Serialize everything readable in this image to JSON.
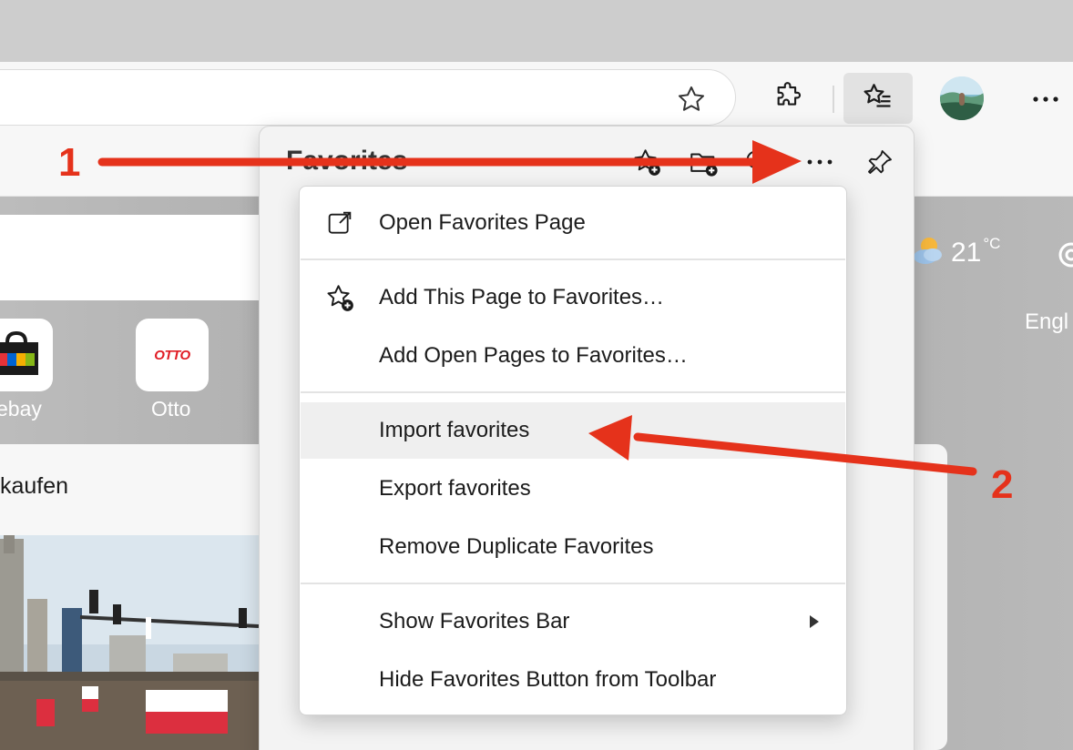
{
  "toolbar": {
    "address_star_icon": "star-outline-icon",
    "extensions_icon": "puzzle-icon",
    "favorites_icon": "star-list-icon",
    "profile_icon": "avatar",
    "more_icon": "ellipsis-icon"
  },
  "newtab": {
    "tiles": [
      {
        "label": "ebay",
        "icon": "shopping-bag-icon"
      },
      {
        "label": "Otto",
        "logo_text": "OTTO",
        "icon": "otto-logo"
      }
    ],
    "news_snippet": "kaufen",
    "weather": {
      "temp": "21",
      "unit": "°C",
      "icon": "partly-cloudy-icon"
    },
    "language_partial": "Engl"
  },
  "favorites_flyout": {
    "title": "Favorites",
    "icons": [
      "add-favorite-icon",
      "add-folder-icon",
      "search-icon",
      "ellipsis-icon",
      "pin-icon"
    ]
  },
  "menu": {
    "items": [
      {
        "label": "Open Favorites Page",
        "icon": "open-external-icon"
      },
      {
        "label": "Add This Page to Favorites…",
        "icon": "star-add-icon"
      },
      {
        "label": "Add Open Pages to Favorites…",
        "icon": ""
      },
      {
        "label": "Import favorites",
        "icon": "",
        "highlighted": true
      },
      {
        "label": "Export favorites",
        "icon": ""
      },
      {
        "label": "Remove Duplicate Favorites",
        "icon": ""
      },
      {
        "label": "Show Favorites Bar",
        "icon": "",
        "has_submenu": true
      },
      {
        "label": "Hide Favorites Button from Toolbar",
        "icon": ""
      }
    ]
  },
  "annotations": {
    "step1": "1",
    "step2": "2",
    "arrow_color": "#e5321b"
  }
}
